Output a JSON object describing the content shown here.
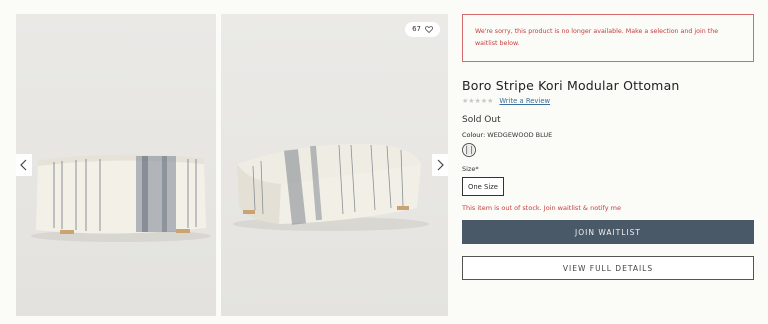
{
  "gallery": {
    "favorite_count": "67",
    "icons": {
      "favorite": "heart-icon",
      "prev": "chevron-left-icon",
      "next": "chevron-right-icon"
    }
  },
  "notice": {
    "text": "We're sorry, this product is no longer available. Make a selection and join the waitlist below."
  },
  "product": {
    "title": "Boro Stripe Kori Modular Ottoman",
    "stars": "★★★★★",
    "review_link": "Write a Review",
    "status": "Sold Out",
    "colour_label": "Colour:",
    "colour_value": "WEDGEWOOD BLUE",
    "size_label": "Size*",
    "size_option": "One Size",
    "stock_message": "This item is out of stock. Join waitlist & notify me"
  },
  "actions": {
    "join_waitlist": "JOIN WAITLIST",
    "view_details": "VIEW FULL DETAILS"
  },
  "colors": {
    "page_bg": "#fbfbf7",
    "error_red": "#c63e3e",
    "waitlist_button": "#4a5968",
    "link_blue": "#3c6e9e"
  }
}
